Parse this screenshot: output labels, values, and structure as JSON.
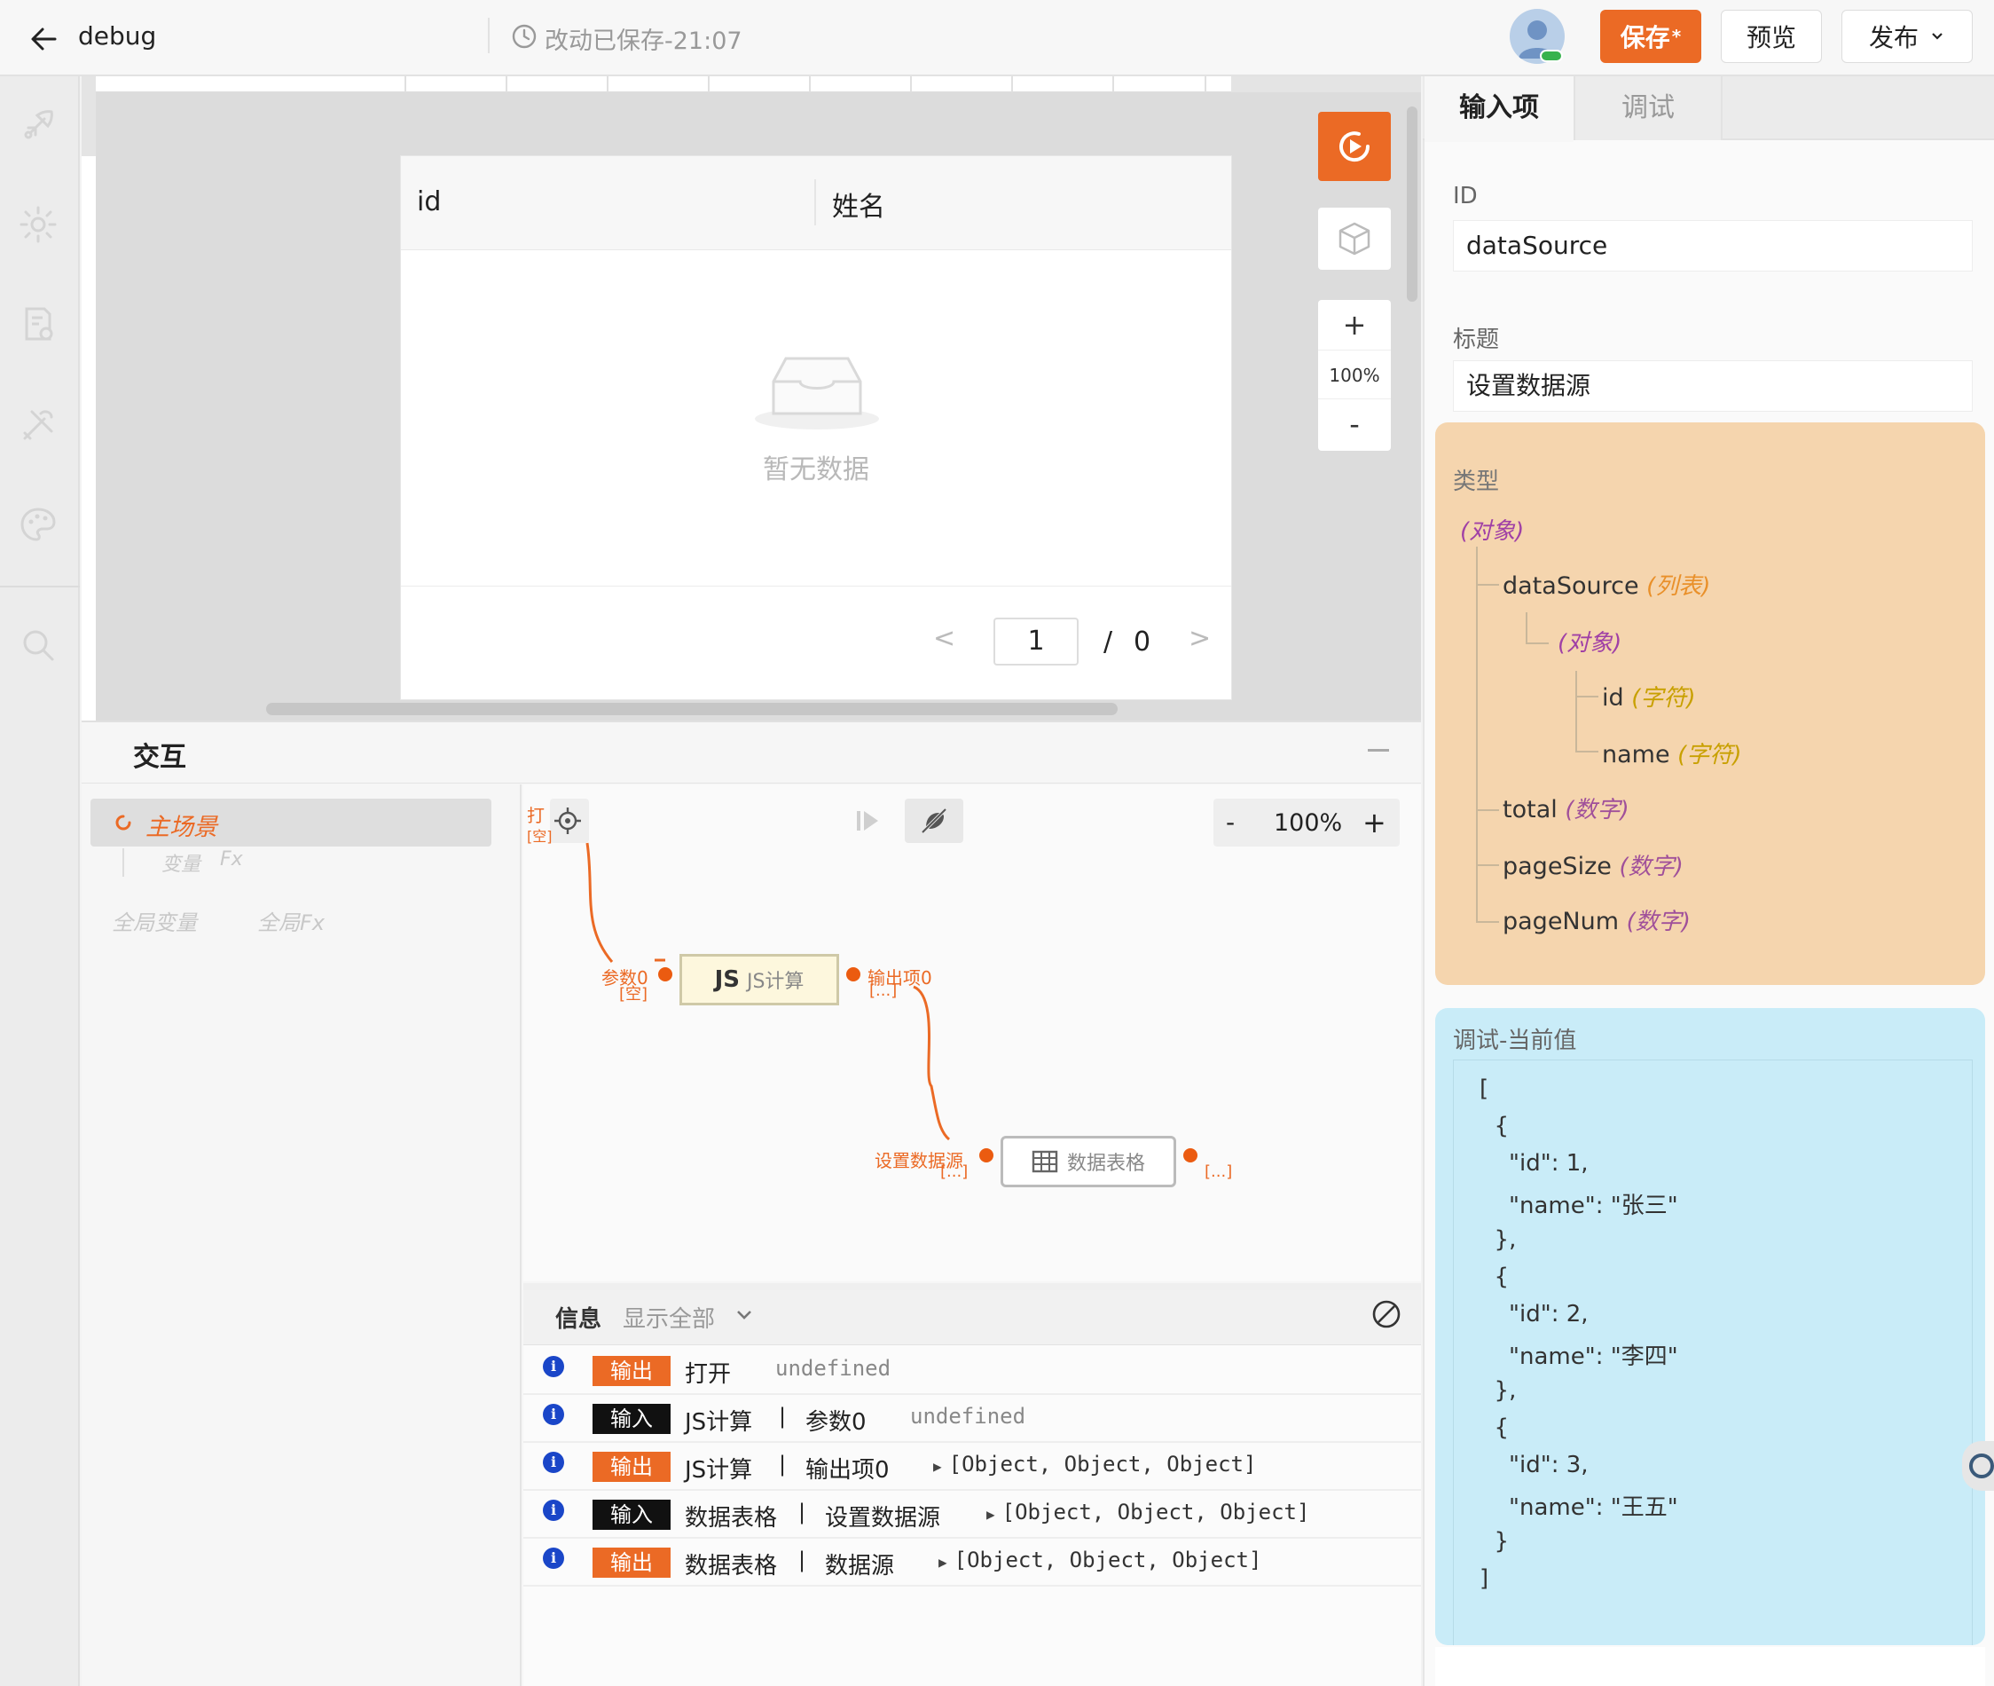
{
  "header": {
    "title": "debug",
    "save_status": "改动已保存-21:07",
    "save_label": "保存",
    "save_dirty_marker": "*",
    "preview_label": "预览",
    "publish_label": "发布"
  },
  "canvas": {
    "table": {
      "columns": [
        "id",
        "姓名"
      ],
      "empty_text": "暂无数据",
      "page_current": "1",
      "page_separator": "/",
      "page_total": "0",
      "prev": "<",
      "next": ">"
    },
    "zoom": {
      "in": "+",
      "level": "100%",
      "out": "-"
    }
  },
  "interaction": {
    "title": "交互",
    "scene_label": "主场景",
    "var_label": "变量",
    "fx_label": "Fx",
    "global_var": "全局变量",
    "global_fx": "全局Fx",
    "open_label": "打",
    "open_sub": "[空]",
    "zoom": {
      "out": "-",
      "level": "100%",
      "in": "+"
    },
    "nodes": {
      "js": {
        "badge": "JS",
        "label": "JS计算",
        "in_port": "参数0",
        "in_sub": "[空]",
        "out_port": "输出项0",
        "out_sub": "[...]"
      },
      "table": {
        "label": "数据表格",
        "in_port": "设置数据源",
        "in_sub": "[...]",
        "out_sub": "[...]"
      }
    }
  },
  "log": {
    "title": "信息",
    "filter": "显示全部",
    "info_glyph": "i",
    "rows": [
      {
        "tag": "输出",
        "kind": "out",
        "component": "打开",
        "port": "",
        "value": "undefined",
        "expandable": false
      },
      {
        "tag": "输入",
        "kind": "in",
        "component": "JS计算",
        "port": "参数0",
        "value": "undefined",
        "expandable": false
      },
      {
        "tag": "输出",
        "kind": "out",
        "component": "JS计算",
        "port": "输出项0",
        "value": "[Object, Object, Object]",
        "expandable": true
      },
      {
        "tag": "输入",
        "kind": "in",
        "component": "数据表格",
        "port": "设置数据源",
        "value": "[Object, Object, Object]",
        "expandable": true
      },
      {
        "tag": "输出",
        "kind": "out",
        "component": "数据表格",
        "port": "数据源",
        "value": "[Object, Object, Object]",
        "expandable": true
      }
    ],
    "separator": "|"
  },
  "right_panel": {
    "tabs": [
      "输入项",
      "调试"
    ],
    "id_label": "ID",
    "id_value": "dataSource",
    "title_label": "标题",
    "title_value": "设置数据源",
    "type_label": "类型",
    "type_tree": {
      "root": "(对象)",
      "datasource": "dataSource",
      "datasource_kind": "(列表)",
      "item": "(对象)",
      "id": "id",
      "id_kind": "(字符)",
      "name": "name",
      "name_kind": "(字符)",
      "total": "total",
      "total_kind": "(数字)",
      "pagesize": "pageSize",
      "pagesize_kind": "(数字)",
      "pagenum": "pageNum",
      "pagenum_kind": "(数字)"
    },
    "debug_label": "调试-当前值",
    "debug_json_lines": [
      "[",
      "  {",
      "    \"id\": 1,",
      "    \"name\": \"张三\"",
      "  },",
      "  {",
      "    \"id\": 2,",
      "    \"name\": \"李四\"",
      "  },",
      "  {",
      "    \"id\": 3,",
      "    \"name\": \"王五\"",
      "  }",
      "]"
    ]
  },
  "colors": {
    "accent": "#eb6a25",
    "type_card": "#f5d5ae",
    "debug_card": "#c9ecf8",
    "info_icon": "#1a46c8"
  }
}
